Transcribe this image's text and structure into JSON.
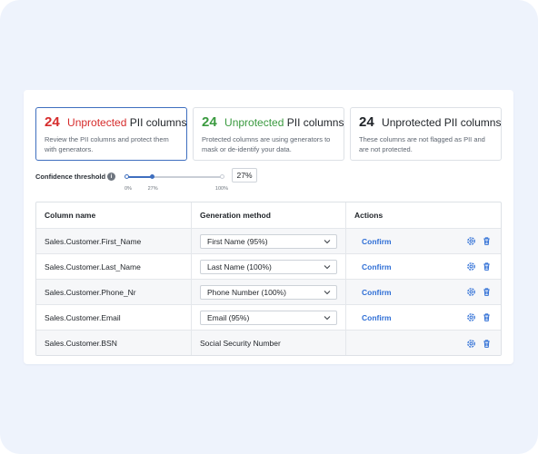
{
  "cards": [
    {
      "count": "24",
      "word": "Unprotected",
      "suffix": "PII columns",
      "color": "#d62c2c",
      "desc": "Review the PII columns and protect them with generators."
    },
    {
      "count": "24",
      "word": "Unprotected",
      "suffix": "PII columns",
      "color": "#3a9a3f",
      "desc": "Protected columns are using generators to mask or de-identify your data."
    },
    {
      "count": "24",
      "word": "Unprotected",
      "suffix": "PII columns",
      "color": "#1f2328",
      "desc": "These columns are not flagged as PII and are not protected."
    }
  ],
  "threshold": {
    "label": "Confidence threshold",
    "info_icon": "info-icon",
    "min_label": "0%",
    "value_label": "27%",
    "max_label": "100%",
    "value": 27,
    "input_value": "27%"
  },
  "table": {
    "headers": {
      "name": "Column name",
      "method": "Generation method",
      "actions": "Actions"
    },
    "rows": [
      {
        "name": "Sales.Customer.First_Name",
        "method": "First Name (95%)",
        "confirm": "Confirm"
      },
      {
        "name": "Sales.Customer.Last_Name",
        "method": "Last Name (100%)",
        "confirm": "Confirm"
      },
      {
        "name": "Sales.Customer.Phone_Nr",
        "method": "Phone Number (100%)",
        "confirm": "Confirm"
      },
      {
        "name": "Sales.Customer.Email",
        "method": "Email (95%)",
        "confirm": "Confirm"
      },
      {
        "name": "Sales.Customer.BSN",
        "method": "Social Security Number",
        "confirm": ""
      }
    ]
  },
  "colors": {
    "accent": "#2f6fd6",
    "danger": "#d62c2c",
    "success": "#3a9a3f"
  }
}
